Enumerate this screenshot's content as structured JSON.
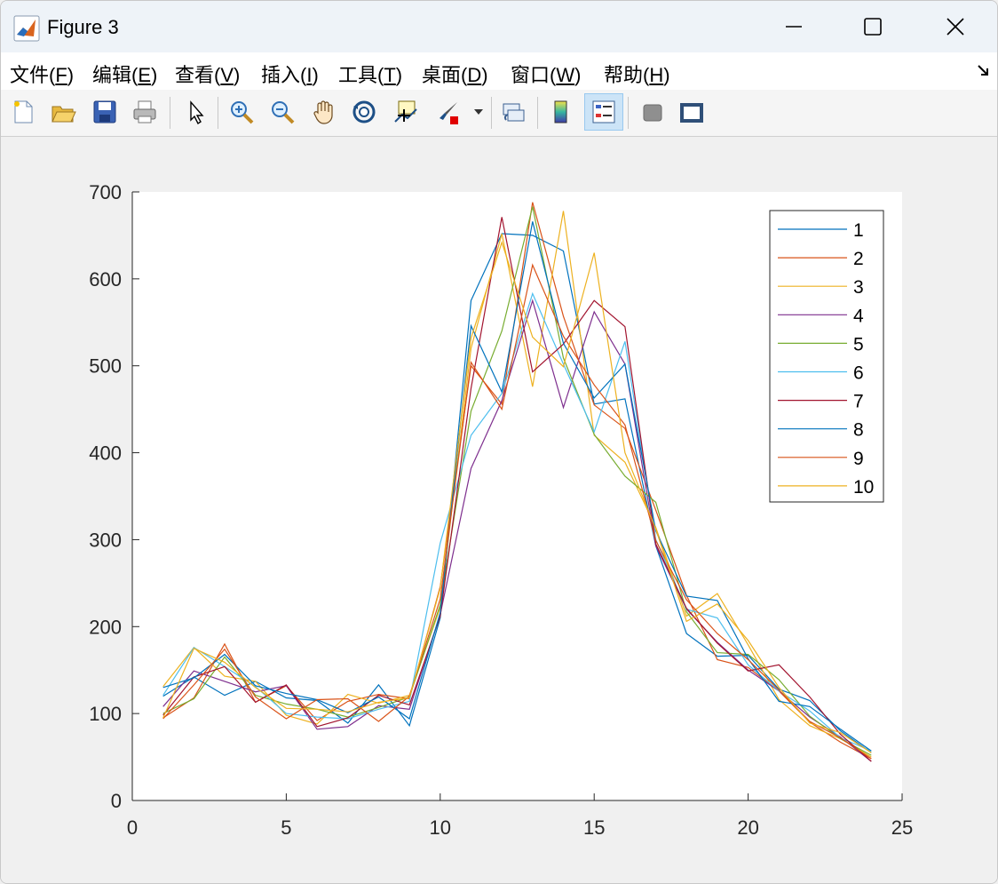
{
  "window": {
    "title": "Figure 3",
    "controls": {
      "minimize": "minimize",
      "maximize": "maximize",
      "close": "close"
    }
  },
  "menu": {
    "items": [
      {
        "label": "文件(",
        "key": "F",
        "suffix": ")"
      },
      {
        "label": "编辑(",
        "key": "E",
        "suffix": ")"
      },
      {
        "label": "查看(",
        "key": "V",
        "suffix": ")"
      },
      {
        "label": "插入(",
        "key": "I",
        "suffix": ")"
      },
      {
        "label": "工具(",
        "key": "T",
        "suffix": ")"
      },
      {
        "label": "桌面(",
        "key": "D",
        "suffix": ")"
      },
      {
        "label": "窗口(",
        "key": "W",
        "suffix": ")"
      },
      {
        "label": "帮助(",
        "key": "H",
        "suffix": ")"
      }
    ]
  },
  "toolbar": {
    "icons": [
      "new-figure-icon",
      "open-file-icon",
      "save-icon",
      "print-icon",
      "pointer-icon",
      "zoom-in-icon",
      "zoom-out-icon",
      "pan-hand-icon",
      "rotate-3d-icon",
      "data-cursor-icon",
      "brush-icon",
      "link-plot-icon",
      "colorbar-icon",
      "legend-icon",
      "hide-plot-tools-icon",
      "show-plot-tools-icon"
    ]
  },
  "colors": {
    "series": [
      "#0072BD",
      "#D95319",
      "#EDB120",
      "#7E2F8E",
      "#77AC30",
      "#4DBEEE",
      "#A2142F",
      "#0072BD",
      "#D95319",
      "#EDB120"
    ]
  },
  "chart_data": {
    "type": "line",
    "title": "",
    "xlabel": "",
    "ylabel": "",
    "xlim": [
      0,
      25
    ],
    "ylim": [
      0,
      700
    ],
    "xticks": [
      0,
      5,
      10,
      15,
      20,
      25
    ],
    "yticks": [
      0,
      100,
      200,
      300,
      400,
      500,
      600,
      700
    ],
    "grid": false,
    "legend_position": "top-right",
    "x": [
      1,
      2,
      3,
      4,
      5,
      6,
      7,
      8,
      9,
      10,
      11,
      12,
      13,
      14,
      15,
      16,
      17,
      18,
      19,
      20,
      21,
      22,
      23,
      24
    ],
    "series": [
      {
        "name": "1",
        "values": [
          120,
          142,
          121,
          137,
          118,
          115,
          89,
          133,
          86,
          210,
          575,
          652,
          650,
          632,
          456,
          462,
          293,
          192,
          166,
          167,
          128,
          115,
          80,
          55
        ]
      },
      {
        "name": "2",
        "values": [
          95,
          118,
          180,
          113,
          132,
          92,
          114,
          122,
          117,
          246,
          500,
          456,
          688,
          557,
          455,
          428,
          334,
          236,
          162,
          153,
          126,
          90,
          67,
          48
        ]
      },
      {
        "name": "3",
        "values": [
          131,
          176,
          143,
          137,
          98,
          88,
          122,
          112,
          121,
          222,
          520,
          652,
          476,
          678,
          420,
          389,
          314,
          212,
          238,
          179,
          116,
          86,
          71,
          50
        ]
      },
      {
        "name": "4",
        "values": [
          108,
          149,
          137,
          125,
          132,
          82,
          85,
          109,
          105,
          214,
          382,
          460,
          575,
          452,
          562,
          502,
          293,
          220,
          182,
          150,
          126,
          96,
          73,
          45
        ]
      },
      {
        "name": "5",
        "values": [
          100,
          117,
          165,
          121,
          111,
          105,
          96,
          107,
          119,
          225,
          448,
          540,
          683,
          509,
          421,
          373,
          343,
          217,
          170,
          168,
          139,
          97,
          71,
          52
        ]
      },
      {
        "name": "6",
        "values": [
          121,
          176,
          154,
          131,
          100,
          96,
          94,
          105,
          114,
          296,
          420,
          468,
          583,
          502,
          424,
          528,
          300,
          220,
          210,
          156,
          126,
          103,
          72,
          57
        ]
      },
      {
        "name": "7",
        "values": [
          98,
          142,
          154,
          113,
          133,
          85,
          95,
          121,
          110,
          212,
          474,
          671,
          493,
          525,
          575,
          545,
          295,
          221,
          181,
          149,
          156,
          119,
          76,
          45
        ]
      },
      {
        "name": "8",
        "values": [
          130,
          141,
          168,
          132,
          123,
          116,
          101,
          119,
          94,
          216,
          546,
          470,
          666,
          526,
          463,
          502,
          310,
          235,
          230,
          163,
          114,
          108,
          82,
          57
        ]
      },
      {
        "name": "9",
        "values": [
          94,
          133,
          174,
          119,
          94,
          116,
          117,
          91,
          120,
          232,
          504,
          450,
          616,
          534,
          478,
          432,
          299,
          231,
          192,
          162,
          127,
          91,
          72,
          48
        ]
      },
      {
        "name": "10",
        "values": [
          95,
          175,
          159,
          130,
          106,
          105,
          102,
          113,
          118,
          244,
          532,
          642,
          533,
          499,
          630,
          400,
          312,
          206,
          226,
          184,
          130,
          89,
          78,
          55
        ]
      }
    ]
  }
}
